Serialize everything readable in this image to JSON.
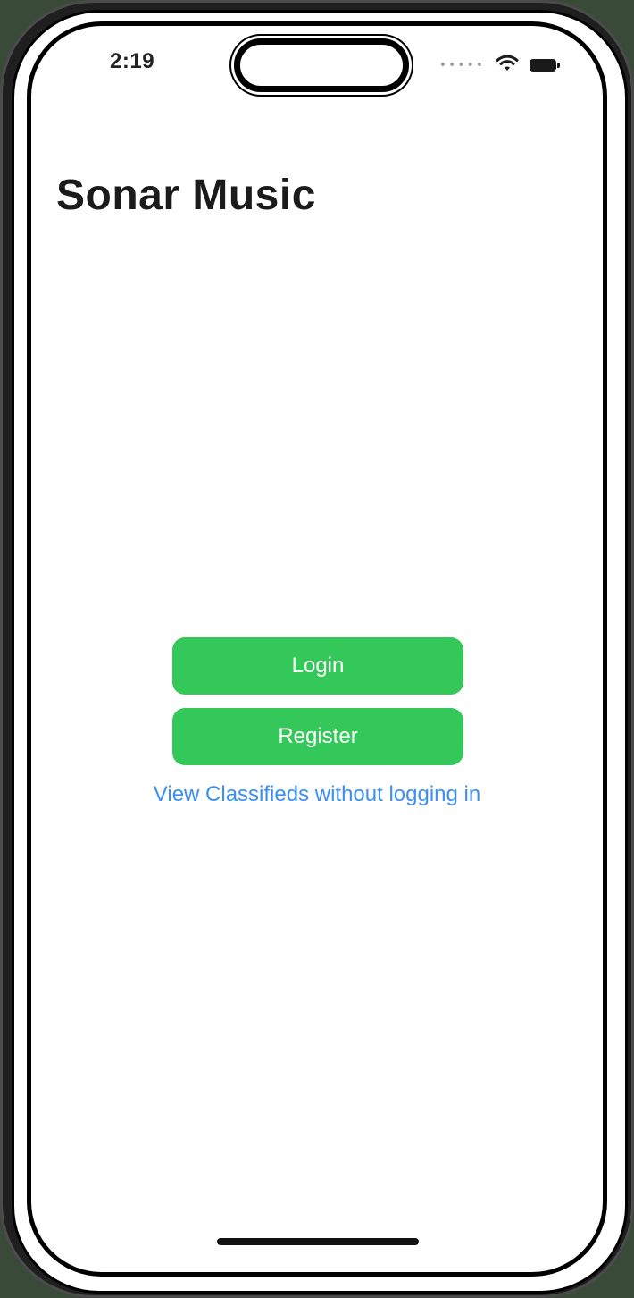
{
  "status_bar": {
    "time": "2:19",
    "signal_icon": "cellular-signal-dots",
    "wifi_icon": "wifi-icon",
    "battery_icon": "battery-icon"
  },
  "app": {
    "title": "Sonar Music"
  },
  "auth": {
    "login_label": "Login",
    "register_label": "Register",
    "guest_link_label": "View Classifieds without logging in"
  },
  "colors": {
    "button_green": "#34c759",
    "link_blue": "#3b8ff2",
    "title_text": "#1b1b1b"
  }
}
